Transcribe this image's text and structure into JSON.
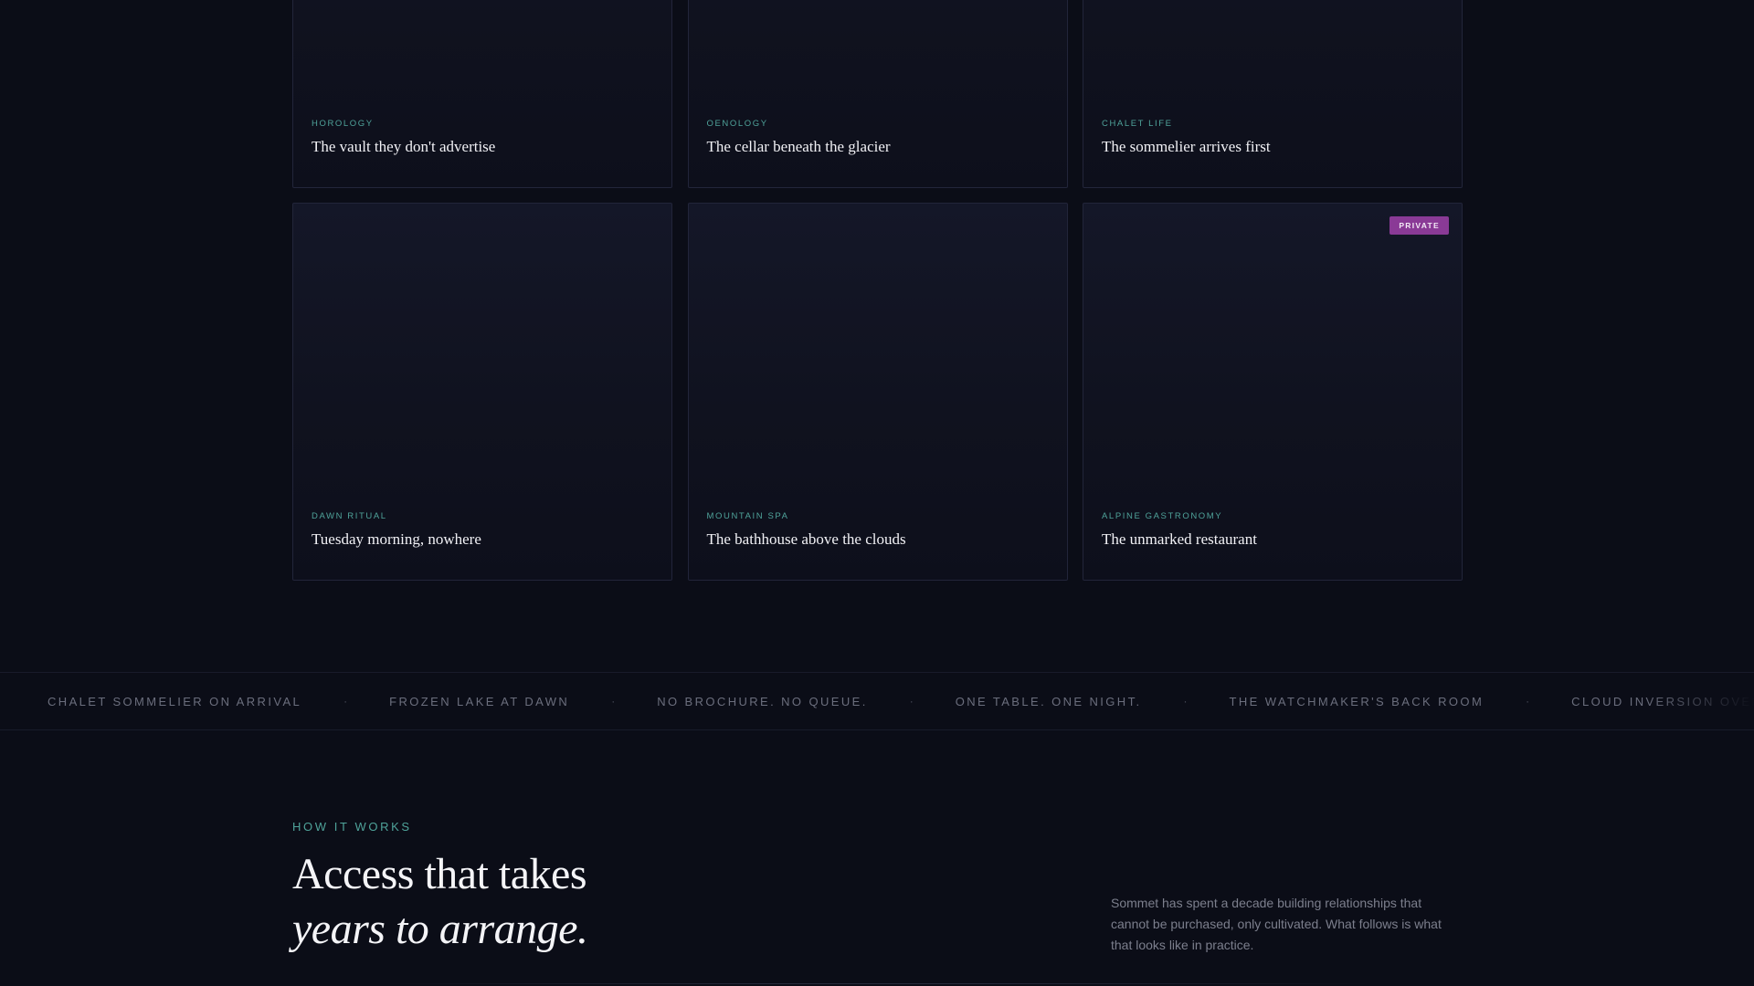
{
  "cards": [
    {
      "category": "HOROLOGY",
      "title": "The vault they don't advertise"
    },
    {
      "category": "OENOLOGY",
      "title": "The cellar beneath the glacier"
    },
    {
      "category": "CHALET LIFE",
      "title": "The sommelier arrives first"
    },
    {
      "category": "DAWN RITUAL",
      "title": "Tuesday morning, nowhere"
    },
    {
      "category": "MOUNTAIN SPA",
      "title": "The bathhouse above the clouds"
    },
    {
      "category": "ALPINE GASTRONOMY",
      "title": "The unmarked restaurant",
      "badge": "PRIVATE"
    }
  ],
  "ticker": {
    "items": [
      "CHALET SOMMELIER ON ARRIVAL",
      "FROZEN LAKE AT DAWN",
      "NO BROCHURE. NO QUEUE.",
      "ONE TABLE. ONE NIGHT.",
      "THE WATCHMAKER'S BACK ROOM",
      "CLOUD INVERSION OVER LUCERNE"
    ],
    "separator": "·"
  },
  "how_it_works": {
    "eyebrow": "HOW IT WORKS",
    "headline_line1": "Access that takes",
    "headline_line2": "years to arrange.",
    "intro": "Sommet has spent a decade building relationships that cannot be purchased, only cultivated. What follows is what that looks like in practice."
  },
  "colors": {
    "background": "#0b0d17",
    "accent_teal": "#4fa39a",
    "badge_purple": "#8a3a96"
  }
}
